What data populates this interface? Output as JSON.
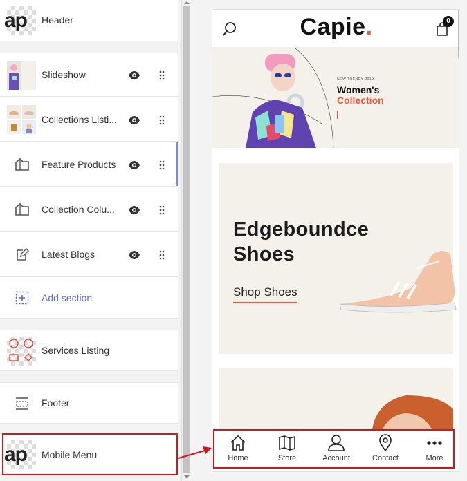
{
  "sections": {
    "header": {
      "label": "Header"
    },
    "slideshow": {
      "label": "Slideshow"
    },
    "collections_listing": {
      "label": "Collections Listi..."
    },
    "feature_products": {
      "label": "Feature Products"
    },
    "collection_columns": {
      "label": "Collection Colu..."
    },
    "latest_blogs": {
      "label": "Latest Blogs"
    },
    "add_section": {
      "label": "Add section"
    },
    "services_listing": {
      "label": "Services Listing"
    },
    "footer": {
      "label": "Footer"
    },
    "mobile_menu": {
      "label": "Mobile Menu"
    }
  },
  "thumb_text": {
    "header": "ap",
    "mobile_menu": "ap"
  },
  "preview": {
    "brand": "Capie",
    "brand_dot": ".",
    "cart_count": "0",
    "hero": {
      "kicker": "NEW TRENDY 2019",
      "title_line1": "Women's",
      "title_line2": "Collection"
    },
    "shoe_card": {
      "title_line1": "Edgeboundce",
      "title_line2": "Shoes",
      "cta": "Shop Shoes"
    }
  },
  "mobile_menu": {
    "items": [
      {
        "label": "Home",
        "icon": "home-icon"
      },
      {
        "label": "Store",
        "icon": "map-icon"
      },
      {
        "label": "Account",
        "icon": "user-icon"
      },
      {
        "label": "Contact",
        "icon": "location-pin-icon"
      },
      {
        "label": "More",
        "icon": "more-dots-icon"
      }
    ]
  },
  "colors": {
    "accent": "#ec5a3c",
    "annotation": "#d5141c",
    "link": "#5b6acd",
    "active_bar": "#7d8ad6"
  }
}
